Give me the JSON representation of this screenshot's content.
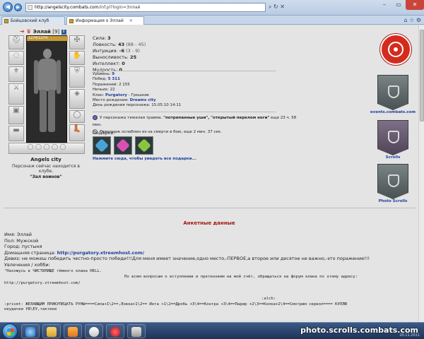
{
  "browser": {
    "address_host": "http://angelscity.combats.com",
    "address_path": "/inf.pl?login=Эллай",
    "tabs": [
      {
        "label": "Бойцовский клуб"
      },
      {
        "label": "Информация о Эллай"
      }
    ]
  },
  "character": {
    "name": "Эллай",
    "level": "[9]",
    "info_icon": "i",
    "hp": "1274/1274",
    "hp_fraction": 1.0,
    "city": "Angels city",
    "location": "Персонаж сейчас находится в клубе.",
    "room": "\"Зал воинов\""
  },
  "stats": [
    {
      "label": "Сила:",
      "value": "3",
      "range": ""
    },
    {
      "label": "Ловкость:",
      "value": "43",
      "range": "(88 - 45)"
    },
    {
      "label": "Интуиция:",
      "value": "-6",
      "range": "(3 - 9)"
    },
    {
      "label": "Выносливость:",
      "value": "25",
      "range": ""
    },
    {
      "label": "Интеллект:",
      "value": "0",
      "range": ""
    },
    {
      "label": "Мудрость:",
      "value": "0",
      "range": ""
    }
  ],
  "info": {
    "level_label": "Уровень:",
    "level_value": "9",
    "wins_label": "Побед:",
    "wins_value": "5 311",
    "losses_label": "Поражений:",
    "losses_value": "2 155",
    "draws_label": "Ничьих:",
    "draws_value": "22",
    "clan_label": "Клан:",
    "clan_value": "Purgatory",
    "clan_rank": "- Грешник",
    "birthplace_label": "Место рождения:",
    "birthplace_value": "Dreams city",
    "birthday_label": "День рождения персонажа:",
    "birthday_value": "15.05.10 14:11"
  },
  "effects": [
    {
      "icon": "trauma-icon",
      "prefix": "У персонажа тяжелая травма.",
      "bold": "\"потрепанные уши\", \"открытый перелом ноги\"",
      "suffix": "еще 23 ч. 58 мин."
    },
    {
      "icon": "weakness-icon",
      "prefix": "Персонаж ослаблен из-за смерти в бою, еще 2 мин. 37 сек.",
      "bold": "",
      "suffix": ""
    }
  ],
  "gifts": {
    "label": "Подарки:",
    "link": "Нажмите сюда, чтобы увидеть все подарки...",
    "items": [
      {
        "icon": "blue-gem-icon",
        "color": "#4aa3d8"
      },
      {
        "icon": "pink-flower-icon",
        "color": "#d94fb5"
      },
      {
        "icon": "green-gem-icon",
        "color": "#8bc53f"
      }
    ]
  },
  "sidebar": {
    "links": [
      {
        "label": "events.combats.com",
        "icon": "events-banner-icon"
      },
      {
        "label": "Scrolls",
        "icon": "scrolls-banner-icon"
      },
      {
        "label": "Photo Scrolls",
        "icon": "photo-scrolls-banner-icon"
      }
    ]
  },
  "profile": {
    "title": "Анкетные данные",
    "name_line": "Имя: Эллай",
    "gender_line": "Пол: Мужской",
    "city_line": "Город: пустыня",
    "homepage_label": "Домашняя страница:",
    "homepage_url": "http://purgatory.xtreemhost.com/",
    "motto": "Девиз: не можеш победить честно-просто победи!!!Для меня имеет значение,одно место,-ПЕРВОЕ,а второе или десятое не важно,-это поражение!!!",
    "hobbies": "Увлечения / хобби:",
    "mono_line1": "\"Нахожусь в ЧИСТИЛИЩЕ тёмного клана HELL.",
    "mono_line2": "По всем вопросам о вступлении и претензиям на мой счёт, обращаться на форум клана по этому адресу:",
    "mono_line3": "http://purgatory.xtreemhost.com/",
    "alch": ":alch:",
    "alch_line1": ":privet:  ЖЕЛАЮЩИМ ПРИКУПЕЦАТЬ  РУНЫ====Сила+1\\2==,Ловка+1\\2== Инта +1\\2==Дробь +3\\4==Контра +3\\4==Парир +2\\3==Колка+2\\4==Смотрим сервол==== КУПЛЮ",
    "alch_line2": "неудачки УВ\\ЕУ,тактики"
  },
  "taskbar": {
    "watermark": "photo.scrolls.combats.com",
    "clock": "20.11.2011"
  },
  "colors": {
    "clan_emblem": "#d42b1e",
    "link_blue": "#1d3f9a",
    "section_title": "#a0150e"
  }
}
